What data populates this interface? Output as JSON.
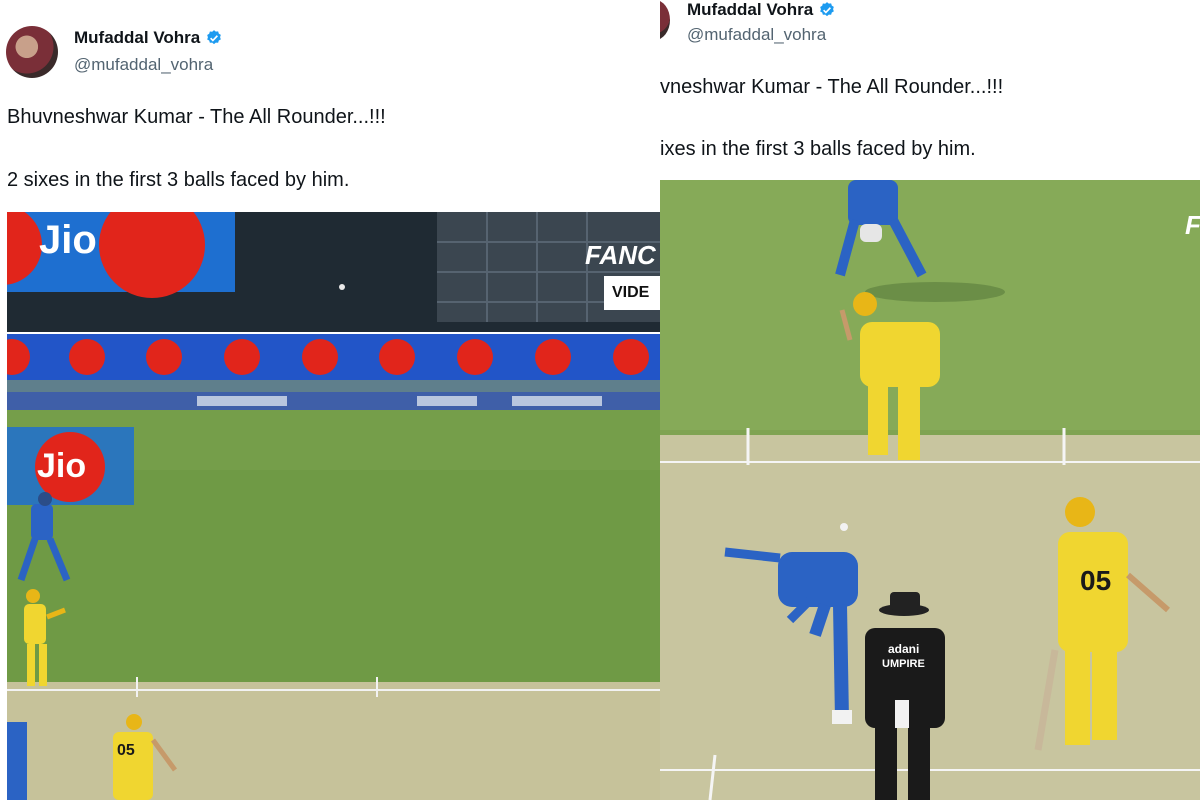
{
  "left_tweet": {
    "display_name": "Mufaddal Vohra",
    "handle": "@mufaddal_vohra",
    "line1": "Bhuvneshwar Kumar - The All Rounder...!!!",
    "line2": "2 sixes in the first 3 balls faced by him.",
    "media": {
      "sponsor": "Jio",
      "overlay_brand": "FANC",
      "overlay_button": "VIDE",
      "jersey_number": "05"
    }
  },
  "right_tweet": {
    "display_name": "Mufaddal Vohra",
    "handle": "@mufaddal_vohra",
    "line1": "vneshwar Kumar - The All Rounder...!!!",
    "line2": "ixes in the first 3 balls faced by him.",
    "media": {
      "overlay_brand": "F",
      "umpire_badge": "adani",
      "umpire_label": "UMPIRE",
      "jersey_number": "05"
    }
  },
  "colors": {
    "verified_blue": "#1d9bf0",
    "jio_red": "#e1251b",
    "jio_blue": "#1e6fd0",
    "grass": "#6f9a45",
    "team_yellow": "#f0d630",
    "team_blue": "#2b63c4"
  }
}
